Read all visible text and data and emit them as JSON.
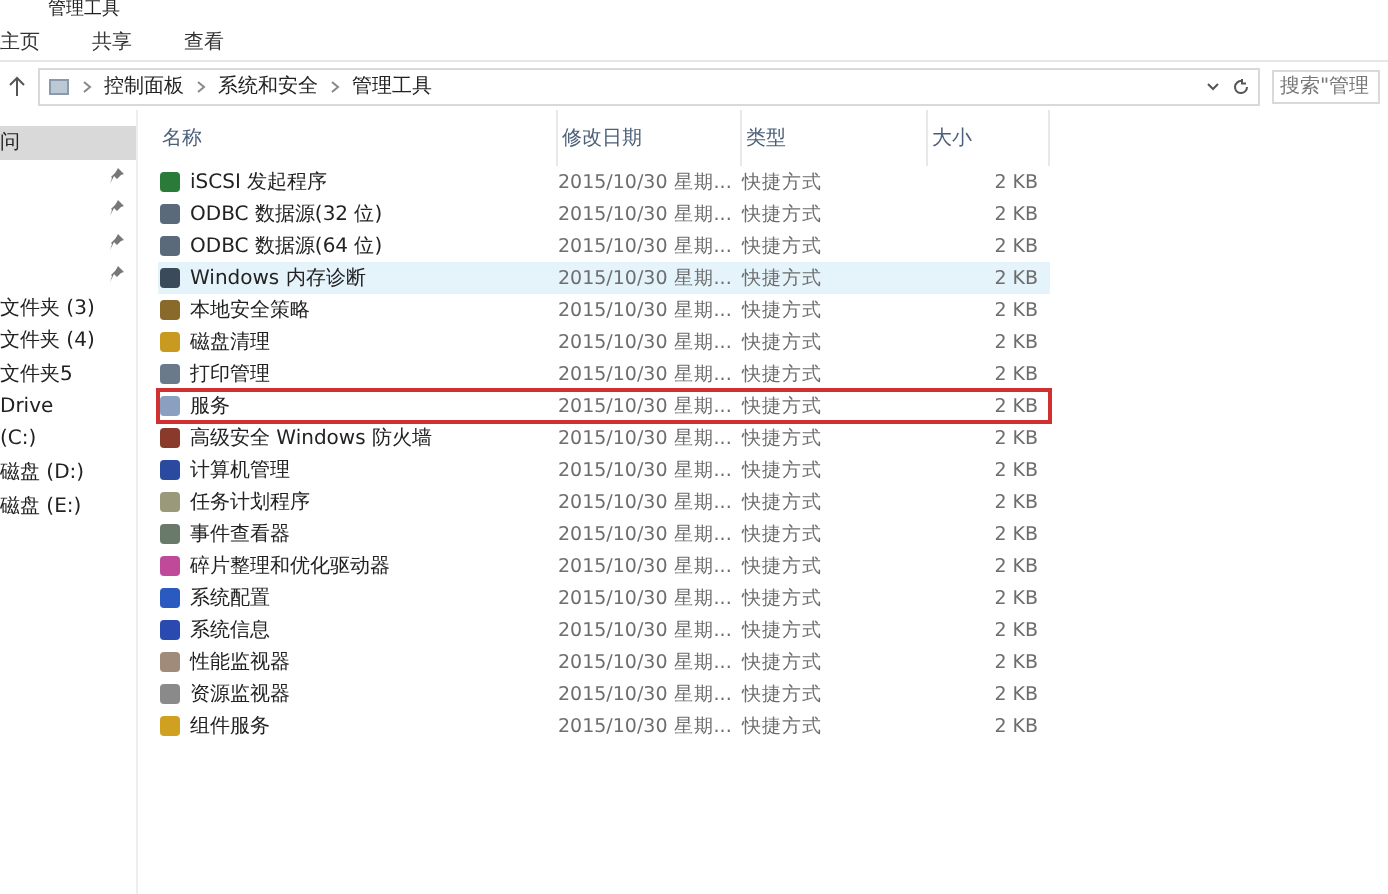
{
  "window": {
    "title": "管理工具"
  },
  "ribbon_tabs": [
    {
      "label": "主页",
      "selected": false
    },
    {
      "label": "共享",
      "selected": false
    },
    {
      "label": "查看",
      "selected": false
    }
  ],
  "address_bar": {
    "path": [
      "控制面板",
      "系统和安全",
      "管理工具"
    ]
  },
  "search": {
    "placeholder": "搜索\"管理"
  },
  "sidebar": {
    "items": [
      {
        "label": "问",
        "selected": true,
        "pinned": false
      },
      {
        "pinned": true
      },
      {
        "pinned": true
      },
      {
        "pinned": true
      },
      {
        "pinned": true
      },
      {
        "label": "文件夹 (3)",
        "selected": false,
        "pinned": false
      },
      {
        "label": "文件夹 (4)",
        "selected": false,
        "pinned": false
      },
      {
        "label": "文件夹5",
        "selected": false,
        "pinned": false
      },
      {
        "label": "Drive",
        "selected": false,
        "pinned": false
      },
      {
        "label": "(C:)",
        "selected": false,
        "pinned": false
      },
      {
        "label": "磁盘 (D:)",
        "selected": false,
        "pinned": false
      },
      {
        "label": "磁盘 (E:)",
        "selected": false,
        "pinned": false
      }
    ]
  },
  "table": {
    "columns": [
      "名称",
      "修改日期",
      "类型",
      "大小"
    ],
    "rows": [
      {
        "name": "iSCSI 发起程序",
        "date": "2015/10/30 星期...",
        "type": "快捷方式",
        "size": "2 KB",
        "hovered": false,
        "outlined": false,
        "color": "#2a7a3a"
      },
      {
        "name": "ODBC 数据源(32 位)",
        "date": "2015/10/30 星期...",
        "type": "快捷方式",
        "size": "2 KB",
        "hovered": false,
        "outlined": false,
        "color": "#5a6a7a"
      },
      {
        "name": "ODBC 数据源(64 位)",
        "date": "2015/10/30 星期...",
        "type": "快捷方式",
        "size": "2 KB",
        "hovered": false,
        "outlined": false,
        "color": "#5a6a7a"
      },
      {
        "name": "Windows 内存诊断",
        "date": "2015/10/30 星期...",
        "type": "快捷方式",
        "size": "2 KB",
        "hovered": true,
        "outlined": false,
        "color": "#3a4a5a"
      },
      {
        "name": "本地安全策略",
        "date": "2015/10/30 星期...",
        "type": "快捷方式",
        "size": "2 KB",
        "hovered": false,
        "outlined": false,
        "color": "#8a6a2a"
      },
      {
        "name": "磁盘清理",
        "date": "2015/10/30 星期...",
        "type": "快捷方式",
        "size": "2 KB",
        "hovered": false,
        "outlined": false,
        "color": "#c89a20"
      },
      {
        "name": "打印管理",
        "date": "2015/10/30 星期...",
        "type": "快捷方式",
        "size": "2 KB",
        "hovered": false,
        "outlined": false,
        "color": "#6a7a8a"
      },
      {
        "name": "服务",
        "date": "2015/10/30 星期...",
        "type": "快捷方式",
        "size": "2 KB",
        "hovered": false,
        "outlined": true,
        "color": "#8aa0c0"
      },
      {
        "name": "高级安全 Windows 防火墙",
        "date": "2015/10/30 星期...",
        "type": "快捷方式",
        "size": "2 KB",
        "hovered": false,
        "outlined": false,
        "color": "#8a3a2a"
      },
      {
        "name": "计算机管理",
        "date": "2015/10/30 星期...",
        "type": "快捷方式",
        "size": "2 KB",
        "hovered": false,
        "outlined": false,
        "color": "#2a4aa0"
      },
      {
        "name": "任务计划程序",
        "date": "2015/10/30 星期...",
        "type": "快捷方式",
        "size": "2 KB",
        "hovered": false,
        "outlined": false,
        "color": "#9a9a7a"
      },
      {
        "name": "事件查看器",
        "date": "2015/10/30 星期...",
        "type": "快捷方式",
        "size": "2 KB",
        "hovered": false,
        "outlined": false,
        "color": "#6a7a6a"
      },
      {
        "name": "碎片整理和优化驱动器",
        "date": "2015/10/30 星期...",
        "type": "快捷方式",
        "size": "2 KB",
        "hovered": false,
        "outlined": false,
        "color": "#c04a9a"
      },
      {
        "name": "系统配置",
        "date": "2015/10/30 星期...",
        "type": "快捷方式",
        "size": "2 KB",
        "hovered": false,
        "outlined": false,
        "color": "#2a5ac0"
      },
      {
        "name": "系统信息",
        "date": "2015/10/30 星期...",
        "type": "快捷方式",
        "size": "2 KB",
        "hovered": false,
        "outlined": false,
        "color": "#2a4ab0"
      },
      {
        "name": "性能监视器",
        "date": "2015/10/30 星期...",
        "type": "快捷方式",
        "size": "2 KB",
        "hovered": false,
        "outlined": false,
        "color": "#a08a7a"
      },
      {
        "name": "资源监视器",
        "date": "2015/10/30 星期...",
        "type": "快捷方式",
        "size": "2 KB",
        "hovered": false,
        "outlined": false,
        "color": "#8a8a8a"
      },
      {
        "name": "组件服务",
        "date": "2015/10/30 星期...",
        "type": "快捷方式",
        "size": "2 KB",
        "hovered": false,
        "outlined": false,
        "color": "#d0a020"
      }
    ]
  }
}
